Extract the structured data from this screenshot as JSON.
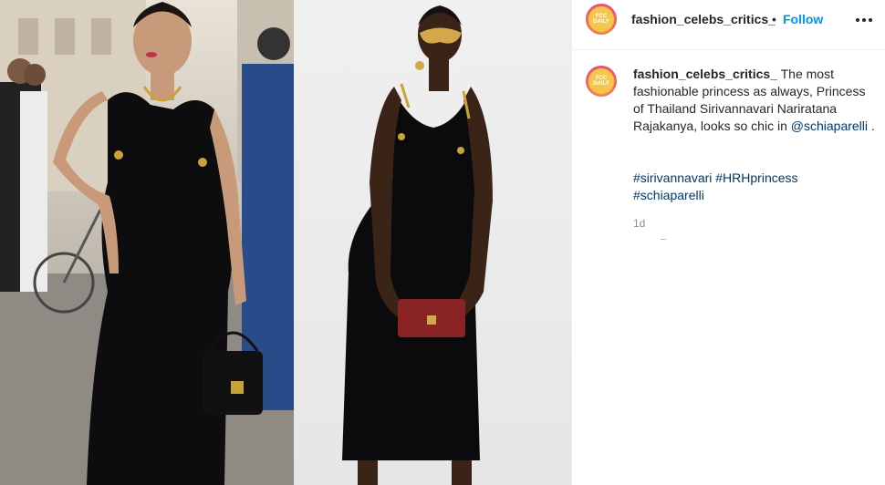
{
  "post": {
    "username": "fashion_celebs_critics_",
    "separator": "•",
    "follow_label": "Follow",
    "avatar_text": "FCC DAILY"
  },
  "caption": {
    "username": "fashion_celebs_critics_",
    "text": "The most fashionable princess as always, Princess of Thailand Sirivannavari Nariratana Rajakanya, looks so chic in",
    "mention": "@schiaparelli",
    "suffix": "."
  },
  "hashtags": [
    "#sirivannavari",
    "#HRHprincess",
    "#schiaparelli"
  ],
  "timestamp": "1d",
  "colors": {
    "link": "#0095f6",
    "mention": "#00376b",
    "muted": "#8e8e8e"
  },
  "icons": {
    "more": "more-options-icon"
  }
}
